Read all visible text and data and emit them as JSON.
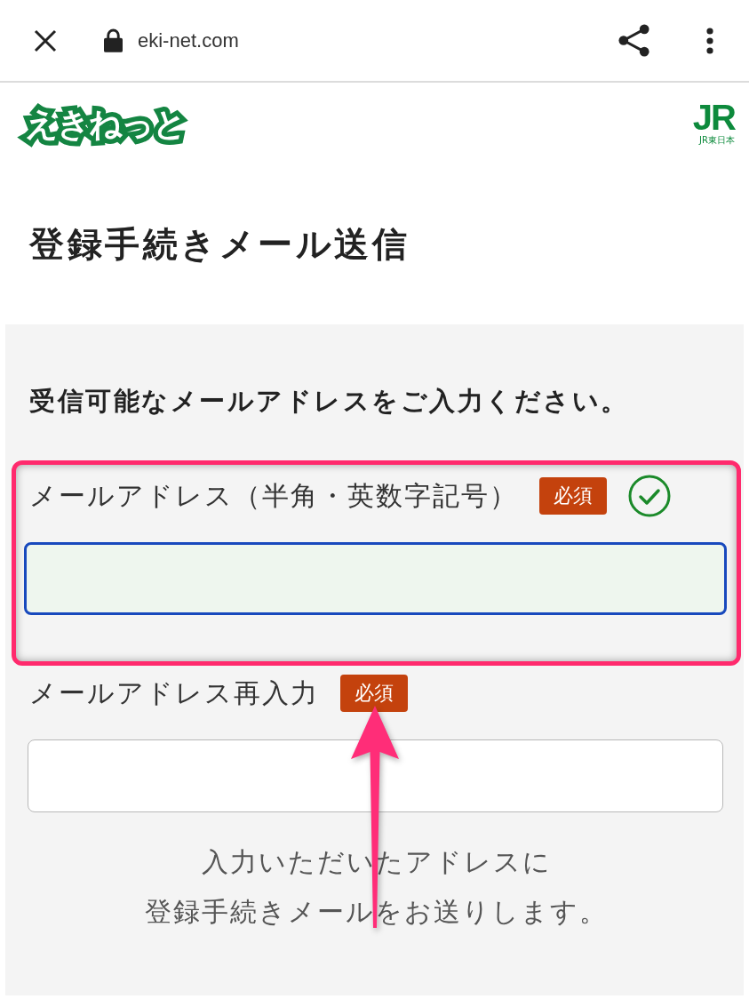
{
  "browser_bar": {
    "url": "eki-net.com"
  },
  "header": {
    "logo": "えきねっと",
    "operator_logo": {
      "mark": "JR",
      "caption": "JR東日本"
    }
  },
  "title": "登録手続きメール送信",
  "form": {
    "instruction": "受信可能なメールアドレスをご入力ください。",
    "fields": [
      {
        "label": "メールアドレス（半角・英数字記号）",
        "badge": "必須",
        "focused": true,
        "valid": true,
        "highlighted": true,
        "arrow": false
      },
      {
        "label": "メールアドレス再入力",
        "badge": "必須",
        "focused": false,
        "valid": false,
        "highlighted": false,
        "arrow": true
      }
    ],
    "note": [
      "入力いただいたアドレスに",
      "登録手続きメールをお送りします。"
    ]
  }
}
